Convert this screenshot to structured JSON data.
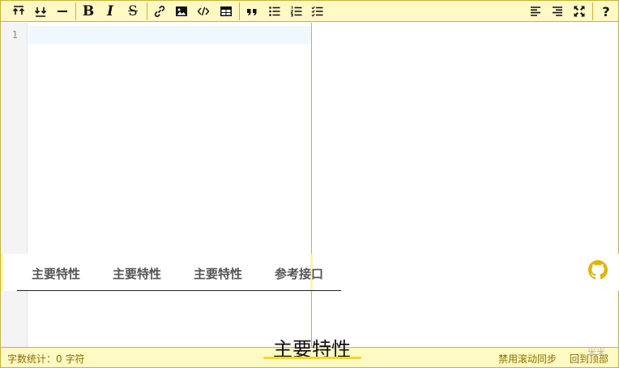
{
  "toolbar": {
    "buttons": [
      {
        "icon": "move-to-top-icon"
      },
      {
        "icon": "move-to-bottom-icon"
      },
      {
        "icon": "horizontal-rule-icon"
      },
      {
        "icon": "bold-icon"
      },
      {
        "icon": "italic-icon"
      },
      {
        "icon": "strikethrough-icon"
      },
      {
        "icon": "link-icon"
      },
      {
        "icon": "image-icon"
      },
      {
        "icon": "code-icon"
      },
      {
        "icon": "table-icon"
      },
      {
        "icon": "blockquote-icon"
      },
      {
        "icon": "unordered-list-icon"
      },
      {
        "icon": "ordered-list-icon"
      },
      {
        "icon": "task-list-icon"
      },
      {
        "icon": "align-left-icon"
      },
      {
        "icon": "align-right-icon"
      },
      {
        "icon": "fullscreen-icon"
      },
      {
        "icon": "help-icon"
      }
    ],
    "labels": {
      "bold": "B",
      "italic": "I",
      "strike": "S",
      "help": "?"
    }
  },
  "editor": {
    "line_number": "1",
    "content": ""
  },
  "nav": {
    "items": [
      "主要特性",
      "主要特性",
      "主要特性",
      "参考接口"
    ],
    "github_icon": "github-icon"
  },
  "statusbar": {
    "word_count": "字数统计：0 字符",
    "disable_scroll_sync": "禁用滚动同步",
    "back_to_top": "回到顶部"
  },
  "overlay": {
    "title": "主要特性",
    "watermark": "米米"
  },
  "colors": {
    "toolbar_bg": "#fff9c4",
    "border": "#c9b23a",
    "status_text": "#8a6d00",
    "accent": "#f3d62b",
    "github": "#e0b400"
  }
}
